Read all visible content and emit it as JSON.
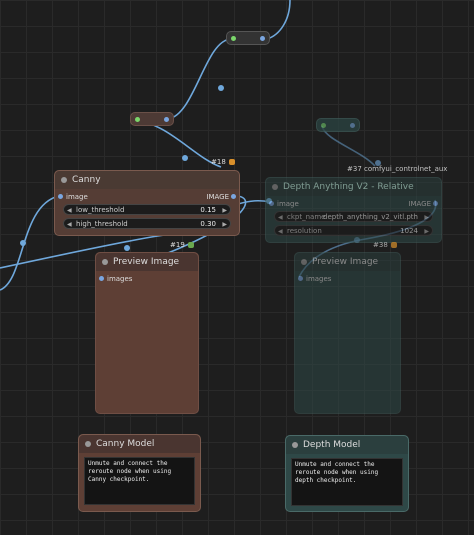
{
  "colors": {
    "canvas": "#1e1e1e",
    "canny_node": "#553d35",
    "depth_node": "#2e4847",
    "wire": "#6fa8dc",
    "input_dot": "#7aa6e0",
    "output_dot": "#7aa6e0",
    "reroute_in": "#7bd66b"
  },
  "canny": {
    "id": "#18",
    "title": "Canny",
    "input": "image",
    "output": "IMAGE",
    "widgets": [
      {
        "label": "low_threshold",
        "value": "0.15"
      },
      {
        "label": "high_threshold",
        "value": "0.30"
      }
    ]
  },
  "depth": {
    "id": "#37 comfyui_controlnet_aux",
    "title": "Depth Anything V2 - Relative",
    "input": "image",
    "output": "IMAGE",
    "widgets": [
      {
        "label": "ckpt_name",
        "value": "depth_anything_v2_vitl.pth"
      },
      {
        "label": "resolution",
        "value": "1024"
      }
    ]
  },
  "preview_canny": {
    "id": "#19",
    "title": "Preview Image",
    "input": "images"
  },
  "preview_depth": {
    "id": "#38",
    "title": "Preview Image",
    "input": "images"
  },
  "note_canny": {
    "title": "Canny Model",
    "text": "Unmute and connect the reroute node when using Canny checkpoint."
  },
  "note_depth": {
    "title": "Depth Model",
    "text": "Unmute and connect the reroute node when using depth checkpoint."
  }
}
